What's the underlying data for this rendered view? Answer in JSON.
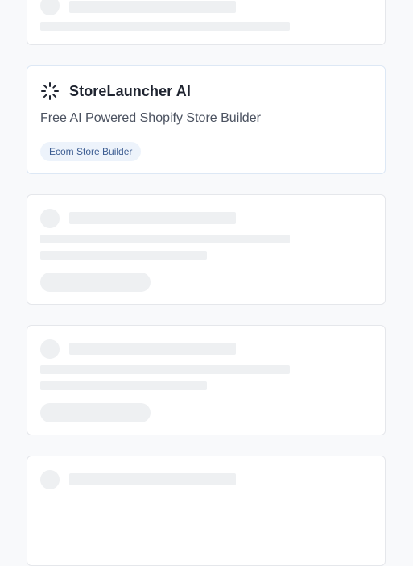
{
  "featured": {
    "logo_icon": "spinner-sparkle-icon",
    "name": "StoreLauncher AI",
    "description": "Free AI Powered Shopify Store Builder",
    "tag": "Ecom Store Builder"
  },
  "colors": {
    "page_bg": "#f8f9fb",
    "card_bg": "#ffffff",
    "skeleton": "#eef0f2",
    "tag_bg": "#edf3fb",
    "tag_text": "#3f5f93"
  }
}
